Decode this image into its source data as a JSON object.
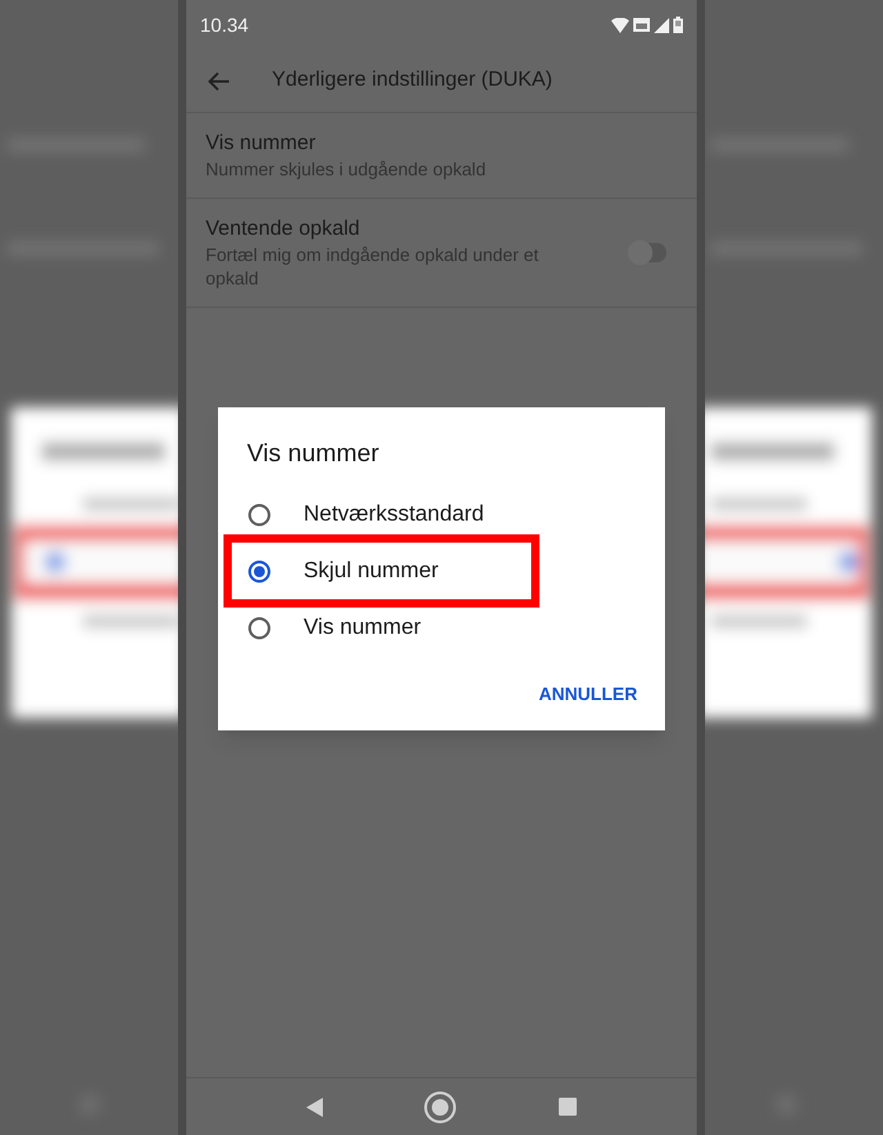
{
  "status_bar": {
    "time": "10.34"
  },
  "app_bar": {
    "title": "Yderligere indstillinger (DUKA)"
  },
  "settings": [
    {
      "kind": "text",
      "title": "Vis nummer",
      "summary": "Nummer skjules i udgående opkald"
    },
    {
      "kind": "switch",
      "title": "Ventende opkald",
      "summary": "Fortæl mig om indgående opkald under et opkald",
      "on": false
    }
  ],
  "dialog": {
    "title": "Vis nummer",
    "options": [
      {
        "label": "Netværksstandard",
        "selected": false,
        "highlighted": false
      },
      {
        "label": "Skjul nummer",
        "selected": true,
        "highlighted": true
      },
      {
        "label": "Vis nummer",
        "selected": false,
        "highlighted": false
      }
    ],
    "buttons": [
      "ANNULLER"
    ]
  }
}
